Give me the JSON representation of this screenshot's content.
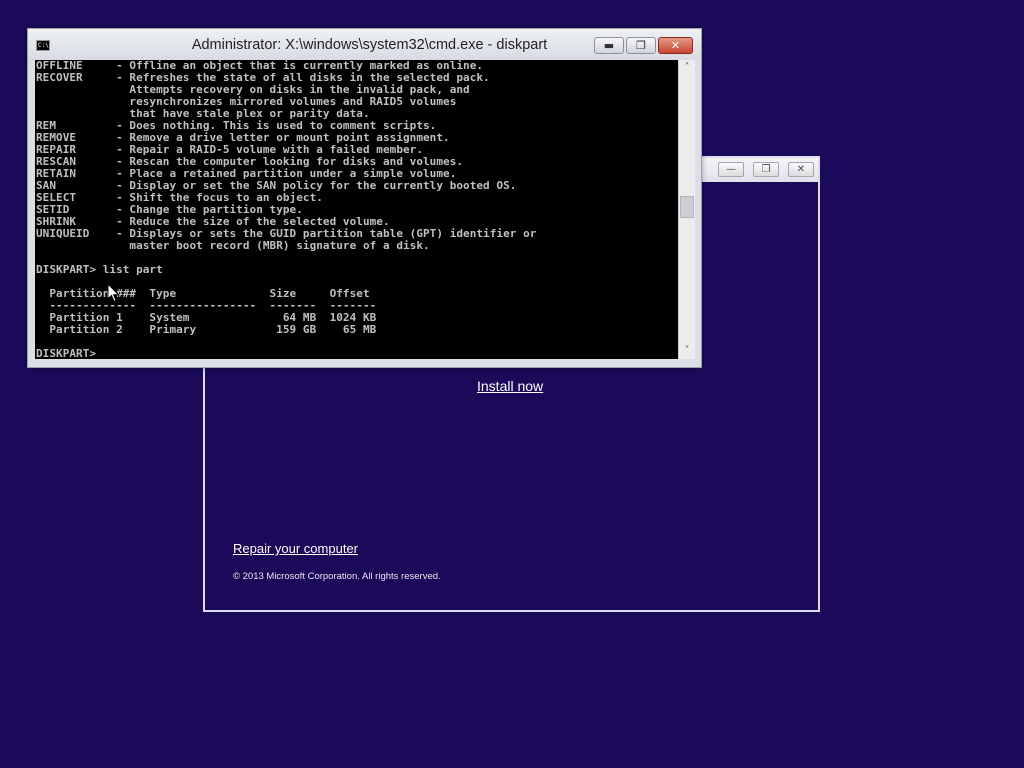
{
  "setup": {
    "minimize_glyph": "—",
    "restore_glyph": "❐",
    "close_glyph": "✕",
    "install_now": "Install now",
    "repair": "Repair your computer",
    "copyright": "© 2013 Microsoft Corporation. All rights reserved."
  },
  "cmd": {
    "icon_text": "C:\\",
    "title": "Administrator: X:\\windows\\system32\\cmd.exe - diskpart",
    "minimize_glyph": "▬",
    "restore_glyph": "❐",
    "close_glyph": "✕",
    "scroll_up": "˄",
    "scroll_down": "˅",
    "lines": [
      "OFFLINE     - Offline an object that is currently marked as online.",
      "RECOVER     - Refreshes the state of all disks in the selected pack.",
      "              Attempts recovery on disks in the invalid pack, and",
      "              resynchronizes mirrored volumes and RAID5 volumes",
      "              that have stale plex or parity data.",
      "REM         - Does nothing. This is used to comment scripts.",
      "REMOVE      - Remove a drive letter or mount point assignment.",
      "REPAIR      - Repair a RAID-5 volume with a failed member.",
      "RESCAN      - Rescan the computer looking for disks and volumes.",
      "RETAIN      - Place a retained partition under a simple volume.",
      "SAN         - Display or set the SAN policy for the currently booted OS.",
      "SELECT      - Shift the focus to an object.",
      "SETID       - Change the partition type.",
      "SHRINK      - Reduce the size of the selected volume.",
      "UNIQUEID    - Displays or sets the GUID partition table (GPT) identifier or",
      "              master boot record (MBR) signature of a disk.",
      "",
      "DISKPART> list part",
      "",
      "  Partition ###  Type              Size     Offset",
      "  -------------  ----------------  -------  -------",
      "  Partition 1    System              64 MB  1024 KB",
      "  Partition 2    Primary            159 GB    65 MB",
      "",
      "DISKPART>"
    ]
  },
  "colors": {
    "desktop": "#1b0a5a",
    "console_bg": "#000000",
    "console_fg": "#c0c0c0"
  }
}
